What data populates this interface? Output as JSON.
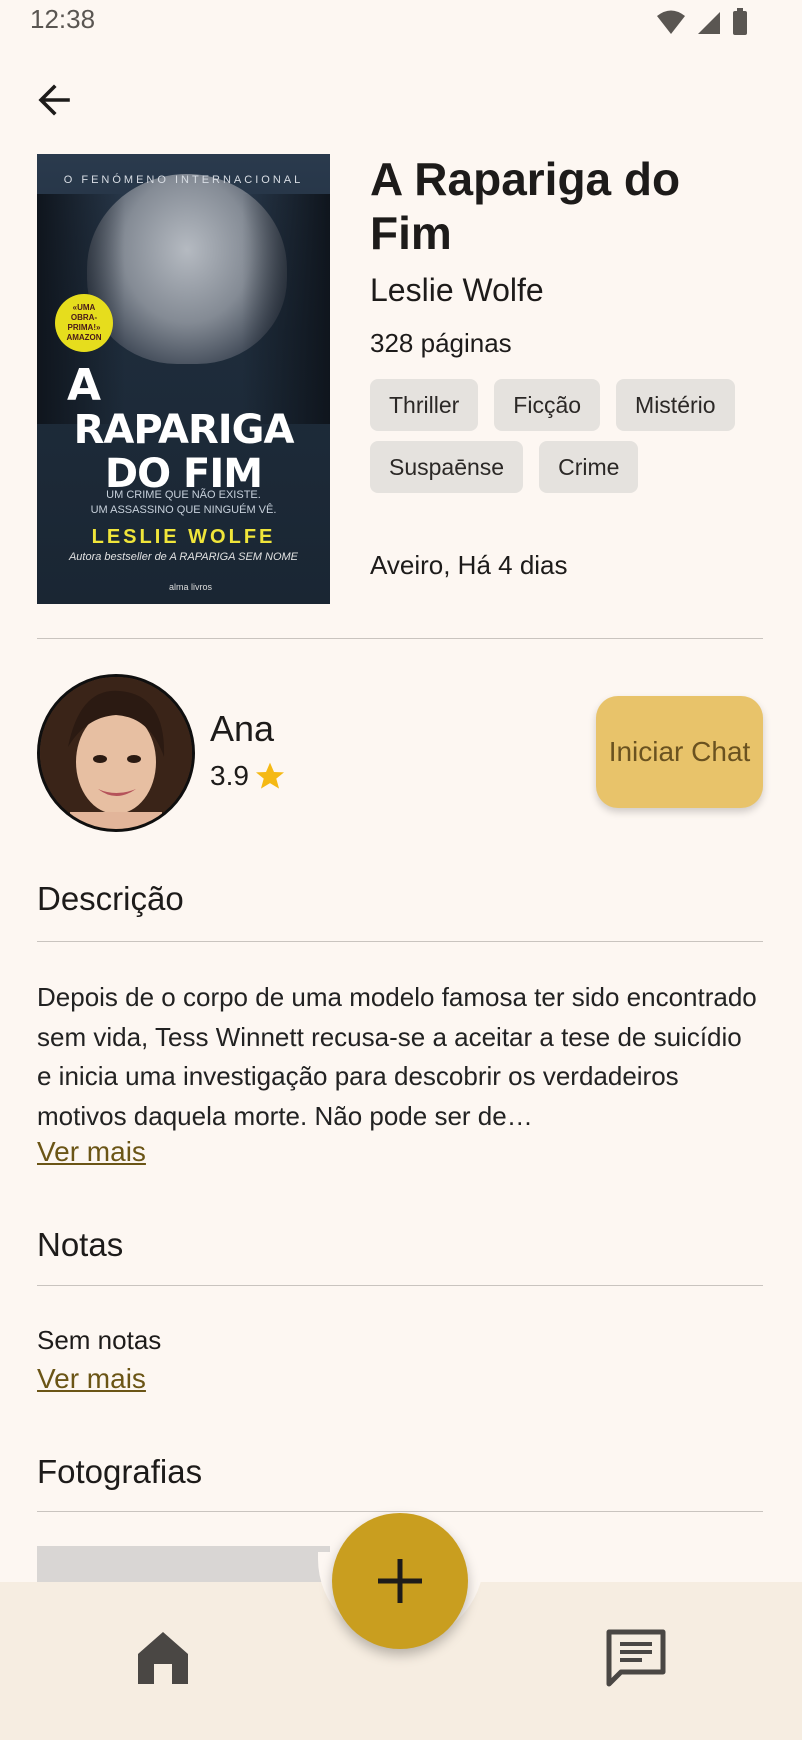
{
  "status_bar": {
    "time": "12:38"
  },
  "book": {
    "title": "A Rapariga do Fim",
    "author": "Leslie Wolfe",
    "pages": "328 páginas",
    "genres": [
      "Thriller",
      "Ficção",
      "Mistério",
      "Suspaēnse",
      "Crime"
    ],
    "location_time": "Aveiro, Há 4 dias",
    "cover": {
      "tagline": "O FENÓMENO INTERNACIONAL",
      "badge": [
        "«UMA",
        "OBRA-PRIMA!»",
        "AMAZON"
      ],
      "title_line1": "A",
      "title_line2": "RAPARIGA",
      "title_line3": "DO FIM",
      "subtitle_line1": "UM CRIME QUE NÃO EXISTE.",
      "subtitle_line2": "UM ASSASSINO QUE NINGUÉM VÊ.",
      "author": "LESLIE WOLFE",
      "author_note": "Autora bestseller de A RAPARIGA SEM NOME",
      "publisher": "alma livros"
    }
  },
  "seller": {
    "name": "Ana",
    "rating": "3.9",
    "chat_button": "Iniciar Chat"
  },
  "description": {
    "title": "Descrição",
    "text": "Depois de o corpo de uma modelo famosa ter sido encontrado sem vida, Tess Winnett recusa-se a aceitar a tese de suicídio e inicia uma investigação para descobrir os verdadeiros motivos daquela morte. Não pode ser de…",
    "more": "Ver mais"
  },
  "notes": {
    "title": "Notas",
    "text": "Sem notas",
    "more": "Ver mais"
  },
  "photos": {
    "title": "Fotografias"
  },
  "colors": {
    "accent": "#c99e1f",
    "chat_button": "#e8c36a",
    "background": "#fdf7f2",
    "nav": "#f6ede1"
  },
  "icons": {
    "back": "arrow-left-icon",
    "star": "star-icon",
    "fab": "plus-icon",
    "home": "home-icon",
    "chat": "chat-icon"
  }
}
